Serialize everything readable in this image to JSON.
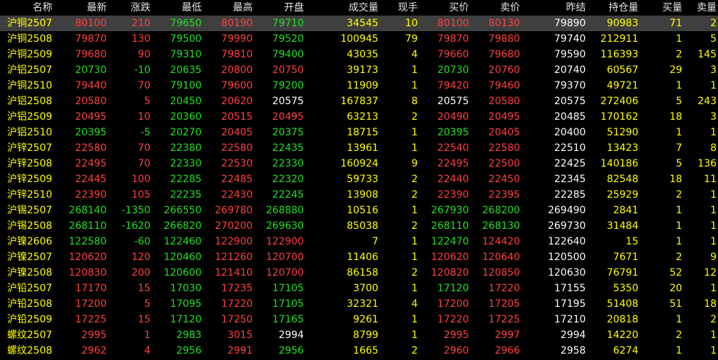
{
  "headers": {
    "name": "名称",
    "last": "最新",
    "change": "涨跌",
    "low": "最低",
    "high": "最高",
    "open": "开盘",
    "volume": "成交量",
    "now_hand": "现手",
    "bid": "买价",
    "ask": "卖价",
    "prev_settle": "昨结",
    "open_interest": "持仓量",
    "bid_qty": "买量",
    "ask_qty": "卖量"
  },
  "colors": {
    "up": "#ff4040",
    "down": "#22e022",
    "flat": "#ffffff",
    "highlight_row": "#3f3f3f"
  },
  "rows": [
    {
      "name": "沪铜2507",
      "last": "80100",
      "change": "210",
      "low": "79650",
      "high": "80190",
      "open": "79710",
      "volume": "34545",
      "now_hand": "10",
      "bid": "80100",
      "ask": "80130",
      "prev_settle": "79890",
      "open_interest": "90983",
      "bid_qty": "71",
      "ask_qty": "2",
      "dir": {
        "last": "up",
        "change": "up",
        "low": "down",
        "high": "up",
        "open": "down",
        "bid": "up",
        "ask": "up"
      }
    },
    {
      "name": "沪铜2508",
      "last": "79870",
      "change": "130",
      "low": "79500",
      "high": "79990",
      "open": "79520",
      "volume": "100945",
      "now_hand": "79",
      "bid": "79870",
      "ask": "79880",
      "prev_settle": "79740",
      "open_interest": "212911",
      "bid_qty": "1",
      "ask_qty": "5",
      "dir": {
        "last": "up",
        "change": "up",
        "low": "down",
        "high": "up",
        "open": "down",
        "bid": "up",
        "ask": "up"
      }
    },
    {
      "name": "沪铜2509",
      "last": "79680",
      "change": "90",
      "low": "79310",
      "high": "79810",
      "open": "79400",
      "volume": "43035",
      "now_hand": "4",
      "bid": "79660",
      "ask": "79680",
      "prev_settle": "79590",
      "open_interest": "116393",
      "bid_qty": "2",
      "ask_qty": "145",
      "dir": {
        "last": "up",
        "change": "up",
        "low": "down",
        "high": "up",
        "open": "down",
        "bid": "up",
        "ask": "up"
      }
    },
    {
      "name": "沪铝2507",
      "last": "20730",
      "change": "-10",
      "low": "20635",
      "high": "20800",
      "open": "20750",
      "volume": "39173",
      "now_hand": "1",
      "bid": "20730",
      "ask": "20760",
      "prev_settle": "20740",
      "open_interest": "60567",
      "bid_qty": "29",
      "ask_qty": "3",
      "dir": {
        "last": "down",
        "change": "down",
        "low": "down",
        "high": "up",
        "open": "up",
        "bid": "down",
        "ask": "up"
      }
    },
    {
      "name": "沪铜2510",
      "last": "79440",
      "change": "70",
      "low": "79100",
      "high": "79600",
      "open": "79200",
      "volume": "11909",
      "now_hand": "1",
      "bid": "79420",
      "ask": "79460",
      "prev_settle": "79370",
      "open_interest": "49721",
      "bid_qty": "1",
      "ask_qty": "1",
      "dir": {
        "last": "up",
        "change": "up",
        "low": "down",
        "high": "up",
        "open": "down",
        "bid": "up",
        "ask": "up"
      }
    },
    {
      "name": "沪铝2508",
      "last": "20580",
      "change": "5",
      "low": "20450",
      "high": "20620",
      "open": "20575",
      "volume": "167837",
      "now_hand": "8",
      "bid": "20575",
      "ask": "20580",
      "prev_settle": "20575",
      "open_interest": "272406",
      "bid_qty": "5",
      "ask_qty": "243",
      "dir": {
        "last": "up",
        "change": "up",
        "low": "down",
        "high": "up",
        "open": "flat",
        "bid": "flat",
        "ask": "up"
      }
    },
    {
      "name": "沪铝2509",
      "last": "20495",
      "change": "10",
      "low": "20360",
      "high": "20515",
      "open": "20495",
      "volume": "63213",
      "now_hand": "2",
      "bid": "20490",
      "ask": "20495",
      "prev_settle": "20485",
      "open_interest": "170162",
      "bid_qty": "18",
      "ask_qty": "3",
      "dir": {
        "last": "up",
        "change": "up",
        "low": "down",
        "high": "up",
        "open": "up",
        "bid": "up",
        "ask": "up"
      }
    },
    {
      "name": "沪铝2510",
      "last": "20395",
      "change": "-5",
      "low": "20270",
      "high": "20405",
      "open": "20375",
      "volume": "18715",
      "now_hand": "1",
      "bid": "20395",
      "ask": "20405",
      "prev_settle": "20400",
      "open_interest": "51290",
      "bid_qty": "1",
      "ask_qty": "1",
      "dir": {
        "last": "down",
        "change": "down",
        "low": "down",
        "high": "up",
        "open": "down",
        "bid": "down",
        "ask": "up"
      }
    },
    {
      "name": "沪锌2507",
      "last": "22580",
      "change": "70",
      "low": "22380",
      "high": "22580",
      "open": "22435",
      "volume": "13961",
      "now_hand": "1",
      "bid": "22540",
      "ask": "22580",
      "prev_settle": "22510",
      "open_interest": "13423",
      "bid_qty": "7",
      "ask_qty": "8",
      "dir": {
        "last": "up",
        "change": "up",
        "low": "down",
        "high": "up",
        "open": "down",
        "bid": "up",
        "ask": "up"
      }
    },
    {
      "name": "沪锌2508",
      "last": "22495",
      "change": "70",
      "low": "22330",
      "high": "22530",
      "open": "22330",
      "volume": "160924",
      "now_hand": "9",
      "bid": "22495",
      "ask": "22500",
      "prev_settle": "22425",
      "open_interest": "140186",
      "bid_qty": "5",
      "ask_qty": "136",
      "dir": {
        "last": "up",
        "change": "up",
        "low": "down",
        "high": "up",
        "open": "down",
        "bid": "up",
        "ask": "up"
      }
    },
    {
      "name": "沪锌2509",
      "last": "22445",
      "change": "100",
      "low": "22285",
      "high": "22485",
      "open": "22320",
      "volume": "59733",
      "now_hand": "2",
      "bid": "22440",
      "ask": "22450",
      "prev_settle": "22345",
      "open_interest": "82548",
      "bid_qty": "18",
      "ask_qty": "11",
      "dir": {
        "last": "up",
        "change": "up",
        "low": "down",
        "high": "up",
        "open": "down",
        "bid": "up",
        "ask": "up"
      }
    },
    {
      "name": "沪锌2510",
      "last": "22390",
      "change": "105",
      "low": "22235",
      "high": "22430",
      "open": "22245",
      "volume": "13908",
      "now_hand": "2",
      "bid": "22390",
      "ask": "22395",
      "prev_settle": "22285",
      "open_interest": "25929",
      "bid_qty": "2",
      "ask_qty": "1",
      "dir": {
        "last": "up",
        "change": "up",
        "low": "down",
        "high": "up",
        "open": "down",
        "bid": "up",
        "ask": "up"
      }
    },
    {
      "name": "沪锡2507",
      "last": "268140",
      "change": "-1350",
      "low": "266550",
      "high": "269780",
      "open": "268880",
      "volume": "10516",
      "now_hand": "1",
      "bid": "267930",
      "ask": "268200",
      "prev_settle": "269490",
      "open_interest": "2841",
      "bid_qty": "1",
      "ask_qty": "1",
      "dir": {
        "last": "down",
        "change": "down",
        "low": "down",
        "high": "up",
        "open": "down",
        "bid": "down",
        "ask": "down"
      }
    },
    {
      "name": "沪锡2508",
      "last": "268110",
      "change": "-1620",
      "low": "266820",
      "high": "270200",
      "open": "269630",
      "volume": "85038",
      "now_hand": "2",
      "bid": "268110",
      "ask": "268130",
      "prev_settle": "269730",
      "open_interest": "31484",
      "bid_qty": "1",
      "ask_qty": "1",
      "dir": {
        "last": "down",
        "change": "down",
        "low": "down",
        "high": "up",
        "open": "down",
        "bid": "down",
        "ask": "down"
      }
    },
    {
      "name": "沪镍2606",
      "last": "122580",
      "change": "-60",
      "low": "122460",
      "high": "122900",
      "open": "122900",
      "volume": "7",
      "now_hand": "1",
      "bid": "122470",
      "ask": "124420",
      "prev_settle": "122640",
      "open_interest": "15",
      "bid_qty": "1",
      "ask_qty": "1",
      "dir": {
        "last": "down",
        "change": "down",
        "low": "down",
        "high": "up",
        "open": "up",
        "bid": "down",
        "ask": "up"
      }
    },
    {
      "name": "沪镍2507",
      "last": "120620",
      "change": "120",
      "low": "120460",
      "high": "121260",
      "open": "120700",
      "volume": "11406",
      "now_hand": "1",
      "bid": "120620",
      "ask": "120640",
      "prev_settle": "120500",
      "open_interest": "7671",
      "bid_qty": "2",
      "ask_qty": "9",
      "dir": {
        "last": "up",
        "change": "up",
        "low": "down",
        "high": "up",
        "open": "up",
        "bid": "up",
        "ask": "up"
      }
    },
    {
      "name": "沪镍2508",
      "last": "120830",
      "change": "200",
      "low": "120600",
      "high": "121410",
      "open": "120700",
      "volume": "86158",
      "now_hand": "2",
      "bid": "120820",
      "ask": "120850",
      "prev_settle": "120630",
      "open_interest": "76791",
      "bid_qty": "52",
      "ask_qty": "12",
      "dir": {
        "last": "up",
        "change": "up",
        "low": "down",
        "high": "up",
        "open": "up",
        "bid": "up",
        "ask": "up"
      }
    },
    {
      "name": "沪铅2507",
      "last": "17170",
      "change": "15",
      "low": "17030",
      "high": "17235",
      "open": "17105",
      "volume": "3700",
      "now_hand": "1",
      "bid": "17120",
      "ask": "17220",
      "prev_settle": "17155",
      "open_interest": "5350",
      "bid_qty": "20",
      "ask_qty": "1",
      "dir": {
        "last": "up",
        "change": "up",
        "low": "down",
        "high": "up",
        "open": "down",
        "bid": "down",
        "ask": "up"
      }
    },
    {
      "name": "沪铅2508",
      "last": "17200",
      "change": "5",
      "low": "17095",
      "high": "17220",
      "open": "17105",
      "volume": "32321",
      "now_hand": "4",
      "bid": "17200",
      "ask": "17205",
      "prev_settle": "17195",
      "open_interest": "51408",
      "bid_qty": "51",
      "ask_qty": "18",
      "dir": {
        "last": "up",
        "change": "up",
        "low": "down",
        "high": "up",
        "open": "down",
        "bid": "up",
        "ask": "up"
      }
    },
    {
      "name": "沪铅2509",
      "last": "17225",
      "change": "15",
      "low": "17120",
      "high": "17250",
      "open": "17165",
      "volume": "9261",
      "now_hand": "1",
      "bid": "17220",
      "ask": "17225",
      "prev_settle": "17210",
      "open_interest": "20818",
      "bid_qty": "1",
      "ask_qty": "2",
      "dir": {
        "last": "up",
        "change": "up",
        "low": "down",
        "high": "up",
        "open": "down",
        "bid": "up",
        "ask": "up"
      }
    },
    {
      "name": "螺纹2507",
      "last": "2995",
      "change": "1",
      "low": "2983",
      "high": "3015",
      "open": "2994",
      "volume": "8799",
      "now_hand": "1",
      "bid": "2995",
      "ask": "2997",
      "prev_settle": "2994",
      "open_interest": "14220",
      "bid_qty": "2",
      "ask_qty": "1",
      "dir": {
        "last": "up",
        "change": "up",
        "low": "down",
        "high": "up",
        "open": "flat",
        "bid": "up",
        "ask": "up"
      }
    },
    {
      "name": "螺纹2508",
      "last": "2962",
      "change": "4",
      "low": "2956",
      "high": "2991",
      "open": "2956",
      "volume": "1665",
      "now_hand": "2",
      "bid": "2960",
      "ask": "2966",
      "prev_settle": "2958",
      "open_interest": "6274",
      "bid_qty": "1",
      "ask_qty": "1",
      "dir": {
        "last": "up",
        "change": "up",
        "low": "down",
        "high": "up",
        "open": "down",
        "bid": "up",
        "ask": "up"
      }
    }
  ]
}
